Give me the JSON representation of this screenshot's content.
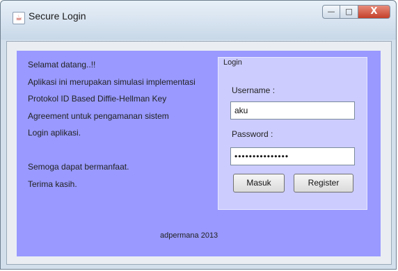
{
  "window": {
    "title": "Secure Login",
    "controls": {
      "minimize": "—",
      "maximize": "□",
      "close": "X"
    }
  },
  "welcome": {
    "lines": [
      "Selamat datang..!!",
      "Aplikasi ini merupakan simulasi implementasi",
      "Protokol ID Based Diffie-Hellman Key",
      "Agreement untuk pengamanan sistem",
      "Login aplikasi.",
      "",
      "Semoga dapat bermanfaat.",
      "Terima kasih."
    ]
  },
  "login": {
    "legend": "Login",
    "username_label": "Username :",
    "username_value": "aku",
    "password_label": "Password :",
    "password_mask": "•••••••••••••••",
    "masuk_label": "Masuk",
    "register_label": "Register"
  },
  "footer": {
    "credit": "adpermana 2013"
  },
  "colors": {
    "panel": "#9999ff",
    "login_box": "#ccccff"
  }
}
